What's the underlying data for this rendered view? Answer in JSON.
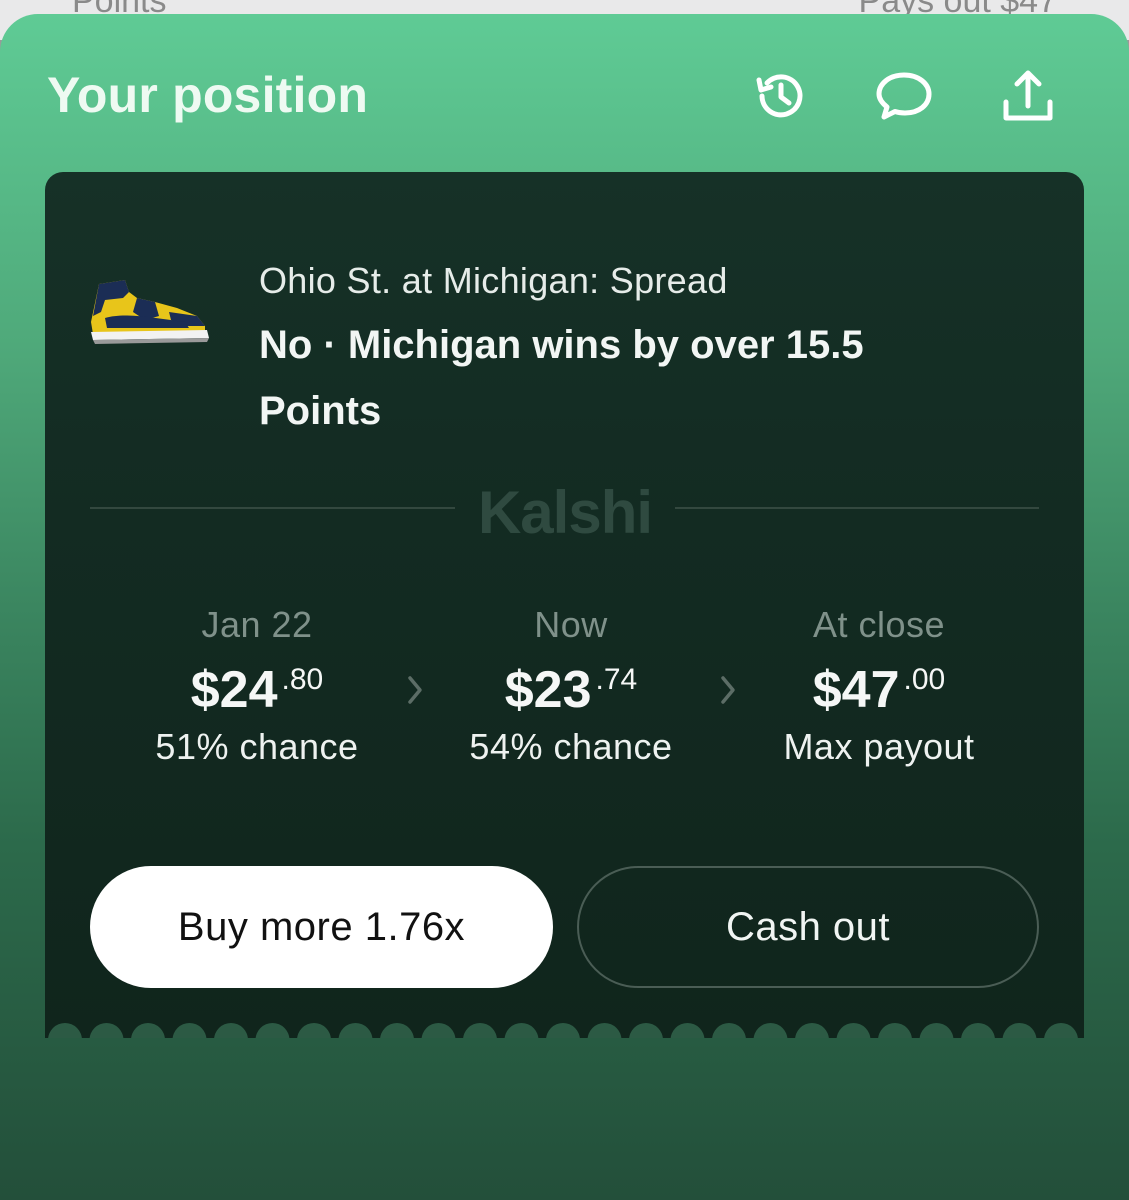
{
  "background": {
    "left_text": "Points",
    "right_text": "Pays out $47"
  },
  "header": {
    "title": "Your position",
    "icons": [
      "history-icon",
      "comment-icon",
      "share-icon"
    ]
  },
  "market": {
    "subtitle": "Ohio St. at Michigan: Spread",
    "title": "No · Michigan wins by over 15.5 Points"
  },
  "brand": "Kalshi",
  "stats": [
    {
      "label": "Jan 22",
      "dollars": "$24",
      "cents": ".80",
      "sub": "51% chance"
    },
    {
      "label": "Now",
      "dollars": "$23",
      "cents": ".74",
      "sub": "54% chance"
    },
    {
      "label": "At close",
      "dollars": "$47",
      "cents": ".00",
      "sub": "Max payout"
    }
  ],
  "actions": {
    "buy_label": "Buy more 1.76x",
    "cash_label": "Cash out"
  },
  "colors": {
    "accent_green": "#5fcb95",
    "card_dark": "#132b22"
  }
}
